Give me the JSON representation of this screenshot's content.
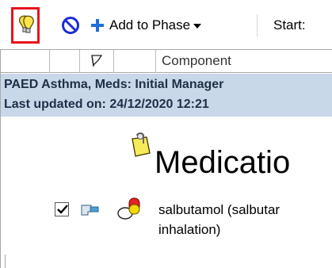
{
  "toolbar": {
    "add_to_phase_label": "Add to Phase",
    "start_label": "Start:",
    "colors": {
      "highlight_border": "#e8141c",
      "plus": "#1e6fd9",
      "no_entry": "#1b2ed8"
    },
    "icons": [
      "lightbulb-icon",
      "no-entry-icon",
      "plus-icon",
      "chevron-down-icon"
    ]
  },
  "grid": {
    "header": {
      "component_label": "Component",
      "flag_icon": "flag-icon"
    },
    "info": {
      "line1": "PAED Asthma, Meds: Initial Manager",
      "line2": "Last updated on: 24/12/2020 12:21",
      "band_color": "#c8d8e9"
    },
    "section": {
      "title": "Medicatio",
      "icon": "note-clip-icon"
    },
    "order": {
      "line1": "salbutamol (salbutar",
      "line2": "inhalation)",
      "checked": true,
      "icons": [
        "inhaler-icon",
        "medication-icon"
      ]
    }
  }
}
